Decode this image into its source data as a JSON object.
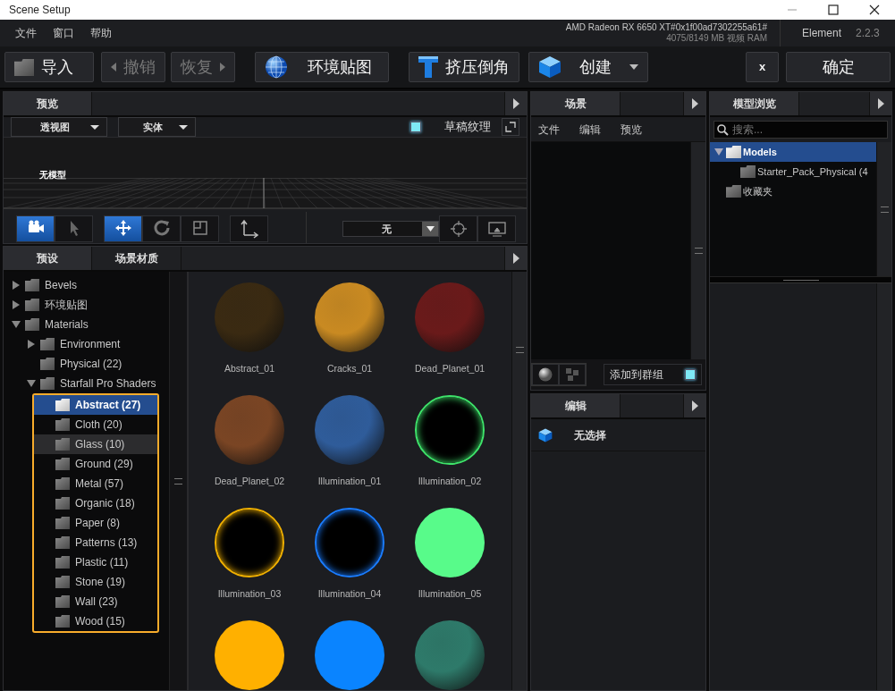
{
  "window": {
    "title": "Scene Setup"
  },
  "menu": [
    "文件",
    "窗口",
    "帮助"
  ],
  "gpu": {
    "name": "AMD Radeon RX 6650 XT#0x1f00ad7302255a61#",
    "memory": "4075/8149 MB 视频 RAM"
  },
  "app": {
    "name": "Element",
    "version": "2.2.3"
  },
  "toolbar": [
    {
      "label": "导入",
      "kind": "import",
      "disabled": false
    },
    {
      "label": "撤销",
      "kind": "undo",
      "disabled": true
    },
    {
      "label": "恢复",
      "kind": "redo",
      "disabled": true
    },
    {
      "label": "环境贴图",
      "kind": "environment",
      "disabled": false
    },
    {
      "label": "挤压倒角",
      "kind": "extrude",
      "disabled": false
    },
    {
      "label": "创建",
      "kind": "create",
      "disabled": false
    },
    {
      "label": "x",
      "kind": "cancel",
      "disabled": false
    },
    {
      "label": "确定",
      "kind": "ok",
      "disabled": false
    }
  ],
  "preview": {
    "tab": "预览",
    "view_mode": "透视图",
    "shading": "实体",
    "draft_texture": {
      "label": "草稿纹理",
      "checked": true
    },
    "empty_label": "无模型",
    "tool_groups": [
      [
        {
          "kind": "camera",
          "selected": true
        },
        {
          "kind": "pointer",
          "selected": false
        }
      ],
      [
        {
          "kind": "move",
          "selected": true
        },
        {
          "kind": "rotate",
          "selected": false
        },
        {
          "kind": "scale",
          "selected": false
        }
      ],
      [
        {
          "kind": "axis",
          "selected": false
        }
      ]
    ],
    "target": "无",
    "view_buttons": [
      {
        "kind": "target"
      },
      {
        "kind": "screen"
      }
    ]
  },
  "presets": {
    "tabs": [
      {
        "label": "预设",
        "selected": true
      },
      {
        "label": "场景材质",
        "selected": false
      }
    ],
    "tree": [
      {
        "label": "Bevels",
        "expanded": false,
        "selected": false,
        "hovered": false
      },
      {
        "label": "环境贴图",
        "expanded": false,
        "selected": false,
        "hovered": false
      },
      {
        "label": "Materials",
        "expanded": true,
        "selected": false,
        "hovered": false,
        "children": [
          {
            "label": "Environment",
            "expanded": false,
            "selected": false,
            "hovered": false
          },
          {
            "label": "Physical (22)",
            "selected": false,
            "hovered": false
          },
          {
            "label": "Starfall Pro Shaders",
            "expanded": true,
            "selected": false,
            "hovered": false,
            "outlined": true,
            "children": [
              {
                "label": "Abstract (27)",
                "selected": true,
                "hovered": false
              },
              {
                "label": "Cloth (20)",
                "selected": false,
                "hovered": false
              },
              {
                "label": "Glass (10)",
                "selected": false,
                "hovered": true
              },
              {
                "label": "Ground (29)",
                "selected": false,
                "hovered": false
              },
              {
                "label": "Metal (57)",
                "selected": false,
                "hovered": false
              },
              {
                "label": "Organic (18)",
                "selected": false,
                "hovered": false
              },
              {
                "label": "Paper (8)",
                "selected": false,
                "hovered": false
              },
              {
                "label": "Patterns (13)",
                "selected": false,
                "hovered": false
              },
              {
                "label": "Plastic (11)",
                "selected": false,
                "hovered": false
              },
              {
                "label": "Stone (19)",
                "selected": false,
                "hovered": false
              },
              {
                "label": "Wall (23)",
                "selected": false,
                "hovered": false
              },
              {
                "label": "Wood (15)",
                "selected": false,
                "hovered": false
              }
            ]
          }
        ]
      }
    ],
    "materials": [
      {
        "name": "Abstract_01",
        "kind": "textured",
        "color": "#3a2a12"
      },
      {
        "name": "Cracks_01",
        "kind": "textured",
        "color": "#c98a22"
      },
      {
        "name": "Dead_Planet_01",
        "kind": "textured",
        "color": "#6a1a1a"
      },
      {
        "name": "Dead_Planet_02",
        "kind": "textured",
        "color": "#7a4524"
      },
      {
        "name": "Illumination_01",
        "kind": "textured",
        "color": "#2f5c9a"
      },
      {
        "name": "Illumination_02",
        "kind": "glow",
        "color": "#3ee36a"
      },
      {
        "name": "Illumination_03",
        "kind": "glow",
        "color": "#f0b000"
      },
      {
        "name": "Illumination_04",
        "kind": "glow",
        "color": "#1a7cff"
      },
      {
        "name": "Illumination_05",
        "kind": "solid",
        "color": "#58fb8a"
      },
      {
        "kind": "solid",
        "color": "#ffb000"
      },
      {
        "kind": "solid",
        "color": "#0a84ff"
      },
      {
        "kind": "textured",
        "color": "#2e7a6a"
      }
    ]
  },
  "scene": {
    "tab": "场景",
    "menu": [
      "文件",
      "编辑",
      "预览"
    ],
    "add_to_group": {
      "label": "添加到群组",
      "checked": true
    }
  },
  "edit": {
    "tab": "编辑",
    "selection": "无选择"
  },
  "browser": {
    "tab": "模型浏览",
    "search": {
      "placeholder": "搜索..."
    },
    "tree": [
      {
        "label": "Models",
        "expanded": true,
        "selected": true,
        "children": [
          {
            "label": "Starter_Pack_Physical (4",
            "selected": false
          }
        ]
      },
      {
        "label": "收藏夹",
        "selected": false
      }
    ]
  }
}
